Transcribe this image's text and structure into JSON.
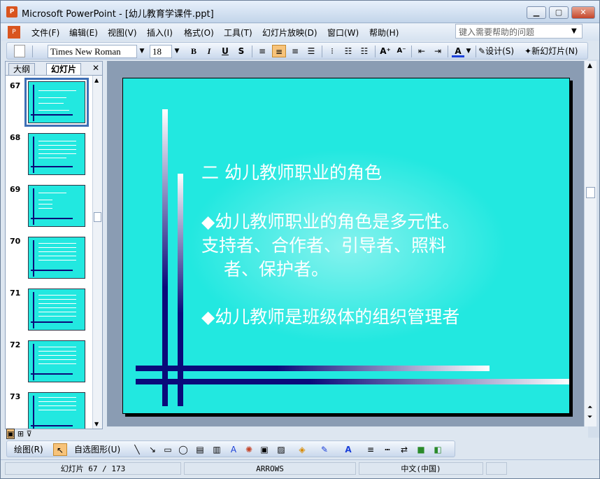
{
  "window": {
    "title": "Microsoft PowerPoint - [幼儿教育学课件.ppt]",
    "app_icon": "powerpoint-icon",
    "controls": {
      "minimize": "▁",
      "maximize": "▢",
      "close": "✕"
    }
  },
  "menu": {
    "items": [
      "文件(F)",
      "编辑(E)",
      "视图(V)",
      "插入(I)",
      "格式(O)",
      "工具(T)",
      "幻灯片放映(D)",
      "窗口(W)",
      "帮助(H)"
    ],
    "help_placeholder": "键入需要帮助的问题"
  },
  "toolbar": {
    "font_name": "Times New Roman",
    "font_size": "18",
    "bold": "B",
    "italic": "I",
    "underline": "U",
    "shadow": "S",
    "design_label": "设计(S)",
    "new_slide_label": "新幻灯片(N)"
  },
  "side_panel": {
    "tabs": [
      "大纲",
      "幻灯片"
    ],
    "close": "✕",
    "slide_numbers": [
      "67",
      "68",
      "69",
      "70",
      "71",
      "72",
      "73"
    ],
    "selected": "67"
  },
  "slide": {
    "heading": "二  幼儿教师职业的角色",
    "bullet1": "◆幼儿教师职业的角色是多元性。",
    "line2": "支持者、合作者、引导者、照料",
    "line3": "者、保护者。",
    "bullet2": "◆幼儿教师是班级体的组织管理者",
    "background_color": "#22e8e0",
    "bar_color": "#0a0a7a"
  },
  "drawing_toolbar": {
    "draw_label": "绘图(R)",
    "autoshapes_label": "自选图形(U)"
  },
  "status": {
    "slide_info": "幻灯片 67 / 173",
    "template": "ARROWS",
    "language": "中文(中国)"
  }
}
